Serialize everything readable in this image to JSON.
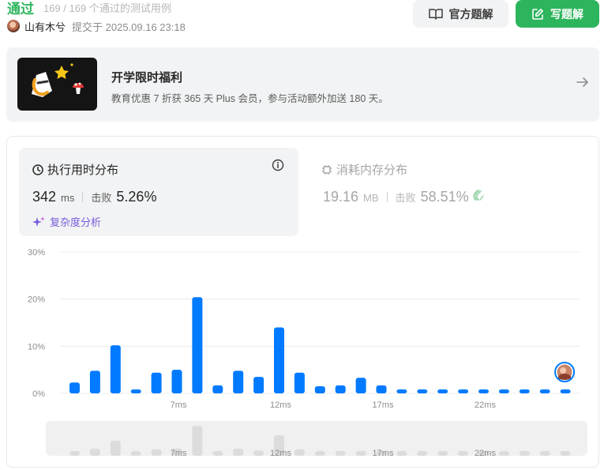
{
  "status": {
    "title": "通过",
    "testcases": "169 / 169 个通过的测试用例"
  },
  "submission": {
    "author": "山有木兮",
    "submitted_at": "提交于 2025.09.16 23:18"
  },
  "actions": {
    "official_solution": "官方题解",
    "write_solution": "写题解"
  },
  "promo": {
    "title": "开学限时福利",
    "description": "教育优惠 7 折获 365 天 Plus 会员，参与活动额外加送 180 天。"
  },
  "runtime": {
    "title": "执行用时分布",
    "value": "342",
    "unit": "ms",
    "beats_label": "击败",
    "beats": "5.26%",
    "complexity_link": "复杂度分析"
  },
  "memory": {
    "title": "消耗内存分布",
    "value": "19.16",
    "unit": "MB",
    "beats_label": "击败",
    "beats": "58.51%"
  },
  "colors": {
    "accent_green": "#2db55d",
    "bar_blue": "#007aff",
    "complexity_purple": "#7a5cde"
  },
  "chart_data": {
    "type": "bar",
    "ylabel": "",
    "xlabel": "",
    "y_ticks": [
      "30%",
      "20%",
      "10%",
      "0%"
    ],
    "ylim": [
      0,
      30
    ],
    "x_tick_labels": [
      {
        "index": 5,
        "label": "7ms"
      },
      {
        "index": 10,
        "label": "12ms"
      },
      {
        "index": 15,
        "label": "17ms"
      },
      {
        "index": 20,
        "label": "22ms"
      }
    ],
    "values": [
      2.3,
      4.8,
      10.2,
      0.8,
      4.4,
      5.0,
      20.4,
      1.7,
      4.8,
      3.5,
      14.0,
      4.4,
      1.5,
      1.7,
      3.3,
      1.7,
      0.7,
      0.7,
      0.7,
      0.7,
      0.7,
      0.7,
      0.7,
      0.7,
      0.7
    ],
    "user_marker_index": 24,
    "grid": true
  }
}
